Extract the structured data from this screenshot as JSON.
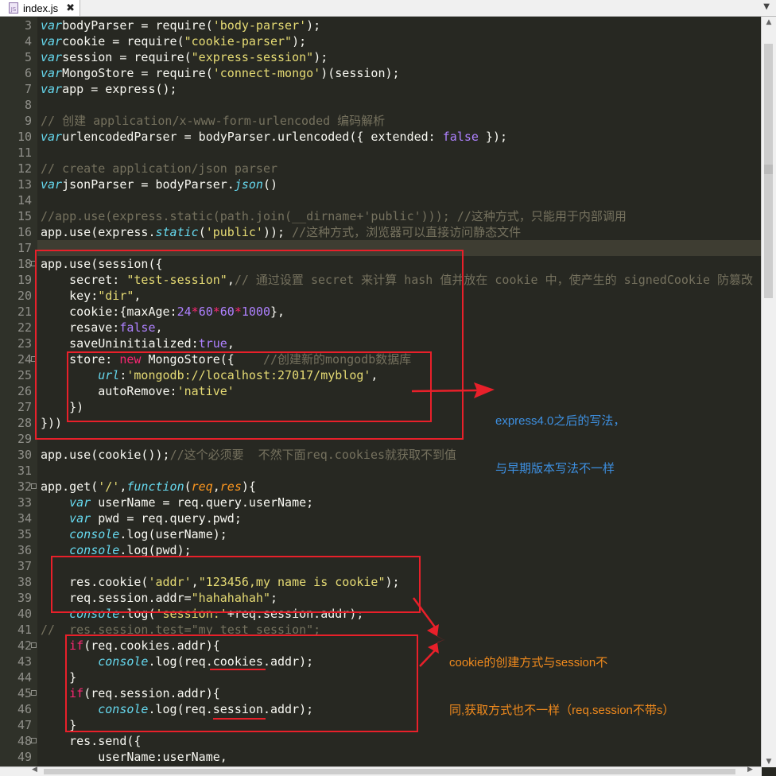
{
  "tab": {
    "file_name": "index.js",
    "icon": "js-file-icon",
    "close_glyph": "✖"
  },
  "editor": {
    "lines": [
      {
        "num": "3",
        "fold": false,
        "tokens": [
          [
            "kw",
            "var"
          ],
          [
            "",
            "bodyParser = require("
          ],
          [
            "str",
            "'body-parser'"
          ],
          [
            "",
            ");"
          ]
        ]
      },
      {
        "num": "4",
        "fold": false,
        "tokens": [
          [
            "kw",
            "var"
          ],
          [
            "",
            "cookie = require("
          ],
          [
            "str",
            "\"cookie-parser\""
          ],
          [
            "",
            ");"
          ]
        ]
      },
      {
        "num": "5",
        "fold": false,
        "tokens": [
          [
            "kw",
            "var"
          ],
          [
            "",
            "session = require("
          ],
          [
            "str",
            "\"express-session\""
          ],
          [
            "",
            ");"
          ]
        ]
      },
      {
        "num": "6",
        "fold": false,
        "tokens": [
          [
            "kw",
            "var"
          ],
          [
            "",
            "MongoStore = require("
          ],
          [
            "str",
            "'connect-mongo'"
          ],
          [
            "",
            ")(session);"
          ]
        ]
      },
      {
        "num": "7",
        "fold": false,
        "tokens": [
          [
            "kw",
            "var"
          ],
          [
            "",
            "app = express();"
          ]
        ]
      },
      {
        "num": "8",
        "fold": false,
        "tokens": []
      },
      {
        "num": "9",
        "fold": false,
        "tokens": [
          [
            "cm",
            "// 创建 application/x-www-form-urlencoded 编码解析"
          ]
        ]
      },
      {
        "num": "10",
        "fold": false,
        "tokens": [
          [
            "kw",
            "var"
          ],
          [
            "",
            "urlencodedParser = bodyParser.urlencoded({ extended: "
          ],
          [
            "num",
            "false"
          ],
          [
            "",
            " });"
          ]
        ]
      },
      {
        "num": "11",
        "fold": false,
        "tokens": []
      },
      {
        "num": "12",
        "fold": false,
        "tokens": [
          [
            "cm",
            "// create application/json parser"
          ]
        ]
      },
      {
        "num": "13",
        "fold": false,
        "tokens": [
          [
            "kw",
            "var"
          ],
          [
            "",
            "jsonParser = bodyParser."
          ],
          [
            "fn",
            "json"
          ],
          [
            "",
            "()"
          ]
        ]
      },
      {
        "num": "14",
        "fold": false,
        "tokens": []
      },
      {
        "num": "15",
        "fold": false,
        "tokens": [
          [
            "cm",
            "//app.use(express.static(path.join(__dirname+'public'))); //这种方式，只能用于内部调用"
          ]
        ]
      },
      {
        "num": "16",
        "fold": false,
        "tokens": [
          [
            "",
            "app.use(express."
          ],
          [
            "fn",
            "static"
          ],
          [
            "",
            "("
          ],
          [
            "str",
            "'public'"
          ],
          [
            "",
            "));"
          ],
          [
            "cm",
            " //这种方式，浏览器可以直接访问静态文件"
          ]
        ]
      },
      {
        "num": "17",
        "fold": false,
        "tokens": []
      },
      {
        "num": "18",
        "fold": true,
        "tokens": [
          [
            "",
            "app.use(session({"
          ]
        ]
      },
      {
        "num": "19",
        "fold": false,
        "tokens": [
          [
            "",
            "    secret: "
          ],
          [
            "str",
            "\"test-session\""
          ],
          [
            "",
            ","
          ],
          [
            "cm",
            "// 通过设置 secret 来计算 hash 值并放在 cookie 中，使产生的 signedCookie 防篡改"
          ]
        ]
      },
      {
        "num": "20",
        "fold": false,
        "tokens": [
          [
            "",
            "    key:"
          ],
          [
            "str",
            "\"dir\""
          ],
          [
            "",
            ","
          ]
        ]
      },
      {
        "num": "21",
        "fold": false,
        "tokens": [
          [
            "",
            "    cookie:{maxAge:"
          ],
          [
            "num",
            "24"
          ],
          [
            "kwr",
            "*"
          ],
          [
            "num",
            "60"
          ],
          [
            "kwr",
            "*"
          ],
          [
            "num",
            "60"
          ],
          [
            "kwr",
            "*"
          ],
          [
            "num",
            "1000"
          ],
          [
            "",
            "},"
          ]
        ]
      },
      {
        "num": "22",
        "fold": false,
        "tokens": [
          [
            "",
            "    resave:"
          ],
          [
            "num",
            "false"
          ],
          [
            "",
            ","
          ]
        ]
      },
      {
        "num": "23",
        "fold": false,
        "tokens": [
          [
            "",
            "    saveUninitialized:"
          ],
          [
            "num",
            "true"
          ],
          [
            "",
            ","
          ]
        ]
      },
      {
        "num": "24",
        "fold": true,
        "tokens": [
          [
            "",
            "    store: "
          ],
          [
            "kwr",
            "new"
          ],
          [
            "",
            " MongoStore({    "
          ],
          [
            "cm",
            "//创建新的mongodb数据库"
          ]
        ]
      },
      {
        "num": "25",
        "fold": false,
        "tokens": [
          [
            "",
            "        "
          ],
          [
            "kw",
            "url"
          ],
          [
            "",
            ":"
          ],
          [
            "str",
            "'mongodb://localhost:27017/myblog'"
          ],
          [
            "",
            ","
          ]
        ]
      },
      {
        "num": "26",
        "fold": false,
        "tokens": [
          [
            "",
            "        autoRemove:"
          ],
          [
            "str",
            "'native'"
          ]
        ]
      },
      {
        "num": "27",
        "fold": false,
        "tokens": [
          [
            "",
            "    })"
          ]
        ]
      },
      {
        "num": "28",
        "fold": false,
        "tokens": [
          [
            "",
            "}))"
          ]
        ]
      },
      {
        "num": "29",
        "fold": false,
        "tokens": []
      },
      {
        "num": "30",
        "fold": false,
        "tokens": [
          [
            "",
            "app.use(cookie());"
          ],
          [
            "cm",
            "//这个必须要  不然下面req.cookies就获取不到值"
          ]
        ]
      },
      {
        "num": "31",
        "fold": false,
        "tokens": []
      },
      {
        "num": "32",
        "fold": true,
        "tokens": [
          [
            "",
            "app.get("
          ],
          [
            "str",
            "'/'"
          ],
          [
            "",
            ","
          ],
          [
            "kw",
            "function"
          ],
          [
            "",
            "("
          ],
          [
            "prm",
            "req"
          ],
          [
            "",
            ","
          ],
          [
            "prm",
            "res"
          ],
          [
            "",
            "){"
          ]
        ]
      },
      {
        "num": "33",
        "fold": false,
        "tokens": [
          [
            "",
            "    "
          ],
          [
            "kw",
            "var"
          ],
          [
            "",
            " userName = req.query.userName;"
          ]
        ]
      },
      {
        "num": "34",
        "fold": false,
        "tokens": [
          [
            "",
            "    "
          ],
          [
            "kw",
            "var"
          ],
          [
            "",
            " pwd = req.query.pwd;"
          ]
        ]
      },
      {
        "num": "35",
        "fold": false,
        "tokens": [
          [
            "",
            "    "
          ],
          [
            "fn",
            "console"
          ],
          [
            "",
            ".log(userName);"
          ]
        ]
      },
      {
        "num": "36",
        "fold": false,
        "tokens": [
          [
            "",
            "    "
          ],
          [
            "fn",
            "console"
          ],
          [
            "",
            ".log(pwd);"
          ]
        ]
      },
      {
        "num": "37",
        "fold": false,
        "tokens": []
      },
      {
        "num": "38",
        "fold": false,
        "tokens": [
          [
            "",
            "    res.cookie("
          ],
          [
            "str",
            "'addr'"
          ],
          [
            "",
            ","
          ],
          [
            "str",
            "\"123456,my name is cookie\""
          ],
          [
            "",
            ");"
          ]
        ]
      },
      {
        "num": "39",
        "fold": false,
        "tokens": [
          [
            "",
            "    req.session.addr="
          ],
          [
            "str",
            "\"hahahahah\""
          ],
          [
            "",
            ";"
          ]
        ]
      },
      {
        "num": "40",
        "fold": false,
        "tokens": [
          [
            "",
            "    "
          ],
          [
            "fn",
            "console"
          ],
          [
            "",
            ".log("
          ],
          [
            "str",
            "'session:'"
          ],
          [
            "",
            "+req.session.addr);"
          ]
        ]
      },
      {
        "num": "41",
        "fold": false,
        "tokens": [
          [
            "cm",
            "//  res.session.test=\"my test session\";"
          ]
        ]
      },
      {
        "num": "42",
        "fold": true,
        "tokens": [
          [
            "",
            "    "
          ],
          [
            "kwr",
            "if"
          ],
          [
            "",
            "(req.cookies.addr){"
          ]
        ]
      },
      {
        "num": "43",
        "fold": false,
        "tokens": [
          [
            "",
            "        "
          ],
          [
            "fn",
            "console"
          ],
          [
            "",
            ".log(req.cookies.addr);"
          ]
        ]
      },
      {
        "num": "44",
        "fold": false,
        "tokens": [
          [
            "",
            "    }"
          ]
        ]
      },
      {
        "num": "45",
        "fold": true,
        "tokens": [
          [
            "",
            "    "
          ],
          [
            "kwr",
            "if"
          ],
          [
            "",
            "(req.session.addr){"
          ]
        ]
      },
      {
        "num": "46",
        "fold": false,
        "tokens": [
          [
            "",
            "        "
          ],
          [
            "fn",
            "console"
          ],
          [
            "",
            ".log(req.session.addr);"
          ]
        ]
      },
      {
        "num": "47",
        "fold": false,
        "tokens": [
          [
            "",
            "    }"
          ]
        ]
      },
      {
        "num": "48",
        "fold": true,
        "tokens": [
          [
            "",
            "    res.send({"
          ]
        ]
      },
      {
        "num": "49",
        "fold": false,
        "tokens": [
          [
            "",
            "        userName:userName,"
          ]
        ]
      }
    ]
  },
  "annotations": {
    "express_note": {
      "line1": "express4.0之后的写法，",
      "line2": "与早期版本写法不一样",
      "color": "#3d8fe0"
    },
    "cookie_note": {
      "line1": "cookie的创建方式与session不",
      "line2": "同,获取方式也不一样（req.session不带s）",
      "color": "#f08a1d"
    },
    "highlight_color": "#e8202a"
  }
}
